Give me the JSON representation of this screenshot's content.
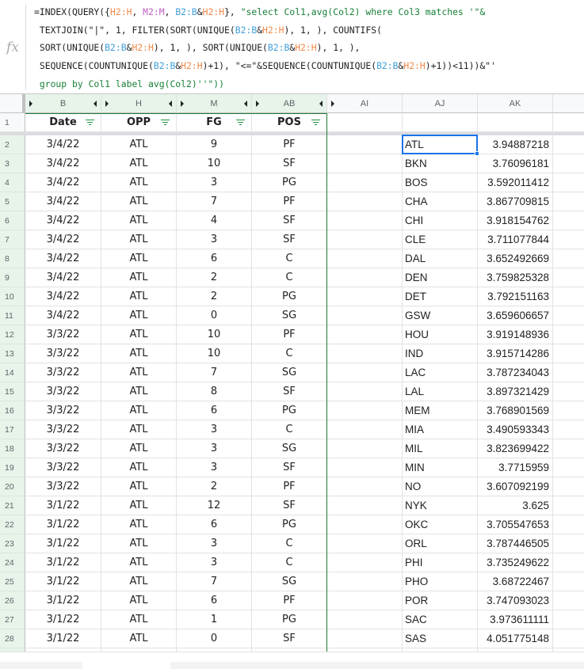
{
  "formula_bar": {
    "icon": "fx-icon",
    "lines": [
      [
        [
          "=INDEX(QUERY({",
          ""
        ],
        [
          "H2:H",
          "h"
        ],
        [
          ", ",
          ""
        ],
        [
          "M2:M",
          "m"
        ],
        [
          ", ",
          ""
        ],
        [
          "B2:B",
          "b"
        ],
        [
          "&",
          ""
        ],
        [
          "H2:H",
          "h"
        ],
        [
          "}, ",
          ""
        ],
        [
          "\"select Col1,avg(Col2) where Col3 matches '\"&",
          "s"
        ]
      ],
      [
        [
          " TEXTJOIN(\"|\", 1, FILTER(SORT(UNIQUE(",
          ""
        ],
        [
          "B2:B",
          "b"
        ],
        [
          "&",
          ""
        ],
        [
          "H2:H",
          "h"
        ],
        [
          "), 1, ), COUNTIFS(",
          ""
        ]
      ],
      [
        [
          " SORT(UNIQUE(",
          ""
        ],
        [
          "B2:B",
          "b"
        ],
        [
          "&",
          ""
        ],
        [
          "H2:H",
          "h"
        ],
        [
          "), 1, ), SORT(UNIQUE(",
          ""
        ],
        [
          "B2:B",
          "b"
        ],
        [
          "&",
          ""
        ],
        [
          "H2:H",
          "h"
        ],
        [
          "), 1, ),",
          ""
        ]
      ],
      [
        [
          " SEQUENCE(COUNTUNIQUE(",
          ""
        ],
        [
          "B2:B",
          "b"
        ],
        [
          "&",
          ""
        ],
        [
          "H2:H",
          "h"
        ],
        [
          ")+1), \"<=\"&SEQUENCE(COUNTUNIQUE(",
          ""
        ],
        [
          "B2:B",
          "b"
        ],
        [
          "&",
          ""
        ],
        [
          "H2:H",
          "h"
        ],
        [
          ")+1))<11))&\"'",
          ""
        ]
      ],
      [
        [
          " group by Col1 label avg(Col2)''\"))",
          "s"
        ]
      ]
    ]
  },
  "columns": [
    {
      "id": "B",
      "grouped": true
    },
    {
      "id": "H",
      "grouped": true
    },
    {
      "id": "M",
      "grouped": true
    },
    {
      "id": "AB",
      "grouped": true
    },
    {
      "id": "AI",
      "grouped": false
    },
    {
      "id": "AJ",
      "grouped": false
    },
    {
      "id": "AK",
      "grouped": false
    },
    {
      "id": "",
      "grouped": false
    }
  ],
  "header_row": {
    "row": "1",
    "cells": [
      "Date",
      "OPP",
      "FG",
      "POS"
    ]
  },
  "rows": [
    {
      "row": "2",
      "date": "3/4/22",
      "opp": "ATL",
      "fg": "9",
      "pos": "PF",
      "team": "ATL",
      "avg": "3.94887218"
    },
    {
      "row": "3",
      "date": "3/4/22",
      "opp": "ATL",
      "fg": "10",
      "pos": "SF",
      "team": "BKN",
      "avg": "3.76096181"
    },
    {
      "row": "4",
      "date": "3/4/22",
      "opp": "ATL",
      "fg": "3",
      "pos": "PG",
      "team": "BOS",
      "avg": "3.592011412"
    },
    {
      "row": "5",
      "date": "3/4/22",
      "opp": "ATL",
      "fg": "7",
      "pos": "PF",
      "team": "CHA",
      "avg": "3.867709815"
    },
    {
      "row": "6",
      "date": "3/4/22",
      "opp": "ATL",
      "fg": "4",
      "pos": "SF",
      "team": "CHI",
      "avg": "3.918154762"
    },
    {
      "row": "7",
      "date": "3/4/22",
      "opp": "ATL",
      "fg": "3",
      "pos": "SF",
      "team": "CLE",
      "avg": "3.711077844"
    },
    {
      "row": "8",
      "date": "3/4/22",
      "opp": "ATL",
      "fg": "6",
      "pos": "C",
      "team": "DAL",
      "avg": "3.652492669"
    },
    {
      "row": "9",
      "date": "3/4/22",
      "opp": "ATL",
      "fg": "2",
      "pos": "C",
      "team": "DEN",
      "avg": "3.759825328"
    },
    {
      "row": "10",
      "date": "3/4/22",
      "opp": "ATL",
      "fg": "2",
      "pos": "PG",
      "team": "DET",
      "avg": "3.792151163"
    },
    {
      "row": "11",
      "date": "3/4/22",
      "opp": "ATL",
      "fg": "0",
      "pos": "SG",
      "team": "GSW",
      "avg": "3.659606657"
    },
    {
      "row": "12",
      "date": "3/3/22",
      "opp": "ATL",
      "fg": "10",
      "pos": "PF",
      "team": "HOU",
      "avg": "3.919148936"
    },
    {
      "row": "13",
      "date": "3/3/22",
      "opp": "ATL",
      "fg": "10",
      "pos": "C",
      "team": "IND",
      "avg": "3.915714286"
    },
    {
      "row": "14",
      "date": "3/3/22",
      "opp": "ATL",
      "fg": "7",
      "pos": "SG",
      "team": "LAC",
      "avg": "3.787234043"
    },
    {
      "row": "15",
      "date": "3/3/22",
      "opp": "ATL",
      "fg": "8",
      "pos": "SF",
      "team": "LAL",
      "avg": "3.897321429"
    },
    {
      "row": "16",
      "date": "3/3/22",
      "opp": "ATL",
      "fg": "6",
      "pos": "PG",
      "team": "MEM",
      "avg": "3.768901569"
    },
    {
      "row": "17",
      "date": "3/3/22",
      "opp": "ATL",
      "fg": "3",
      "pos": "C",
      "team": "MIA",
      "avg": "3.490593343"
    },
    {
      "row": "18",
      "date": "3/3/22",
      "opp": "ATL",
      "fg": "3",
      "pos": "SG",
      "team": "MIL",
      "avg": "3.823699422"
    },
    {
      "row": "19",
      "date": "3/3/22",
      "opp": "ATL",
      "fg": "3",
      "pos": "SF",
      "team": "MIN",
      "avg": "3.7715959"
    },
    {
      "row": "20",
      "date": "3/3/22",
      "opp": "ATL",
      "fg": "2",
      "pos": "PF",
      "team": "NO",
      "avg": "3.607092199"
    },
    {
      "row": "21",
      "date": "3/1/22",
      "opp": "ATL",
      "fg": "12",
      "pos": "SF",
      "team": "NYK",
      "avg": "3.625"
    },
    {
      "row": "22",
      "date": "3/1/22",
      "opp": "ATL",
      "fg": "6",
      "pos": "PG",
      "team": "OKC",
      "avg": "3.705547653"
    },
    {
      "row": "23",
      "date": "3/1/22",
      "opp": "ATL",
      "fg": "3",
      "pos": "C",
      "team": "ORL",
      "avg": "3.787446505"
    },
    {
      "row": "24",
      "date": "3/1/22",
      "opp": "ATL",
      "fg": "3",
      "pos": "C",
      "team": "PHI",
      "avg": "3.735249622"
    },
    {
      "row": "25",
      "date": "3/1/22",
      "opp": "ATL",
      "fg": "7",
      "pos": "SG",
      "team": "PHO",
      "avg": "3.68722467"
    },
    {
      "row": "26",
      "date": "3/1/22",
      "opp": "ATL",
      "fg": "6",
      "pos": "PF",
      "team": "POR",
      "avg": "3.747093023"
    },
    {
      "row": "27",
      "date": "3/1/22",
      "opp": "ATL",
      "fg": "1",
      "pos": "PG",
      "team": "SAC",
      "avg": "3.973611111"
    },
    {
      "row": "28",
      "date": "3/1/22",
      "opp": "ATL",
      "fg": "0",
      "pos": "SF",
      "team": "SAS",
      "avg": "4.051775148"
    }
  ],
  "selection": {
    "cell": "AJ2",
    "value": "ATL"
  },
  "colors": {
    "accent": "#1a73e8",
    "filter_green": "#1e8e3e",
    "group_bg": "#e6f4ea",
    "frame_green": "#1e7b34"
  }
}
